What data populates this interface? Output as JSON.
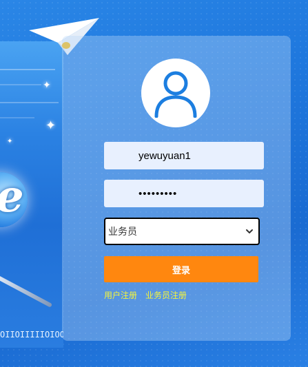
{
  "art": {
    "binary_text": "OIIOIIIIIOIOOO"
  },
  "login": {
    "username_value": "yewuyuan1",
    "password_mask": "•••••••••",
    "role_selected": "业务员",
    "submit_label": "登录",
    "links": {
      "user_register": "用户注册",
      "staff_register": "业务员注册"
    }
  },
  "colors": {
    "accent_button": "#ff870f",
    "link_text": "#f5f53a",
    "avatar_stroke": "#1c7ee0"
  },
  "icons": {
    "avatar": "user-avatar-icon",
    "select_chevron": "chevron-down-icon",
    "paper_plane": "paper-plane-icon"
  }
}
